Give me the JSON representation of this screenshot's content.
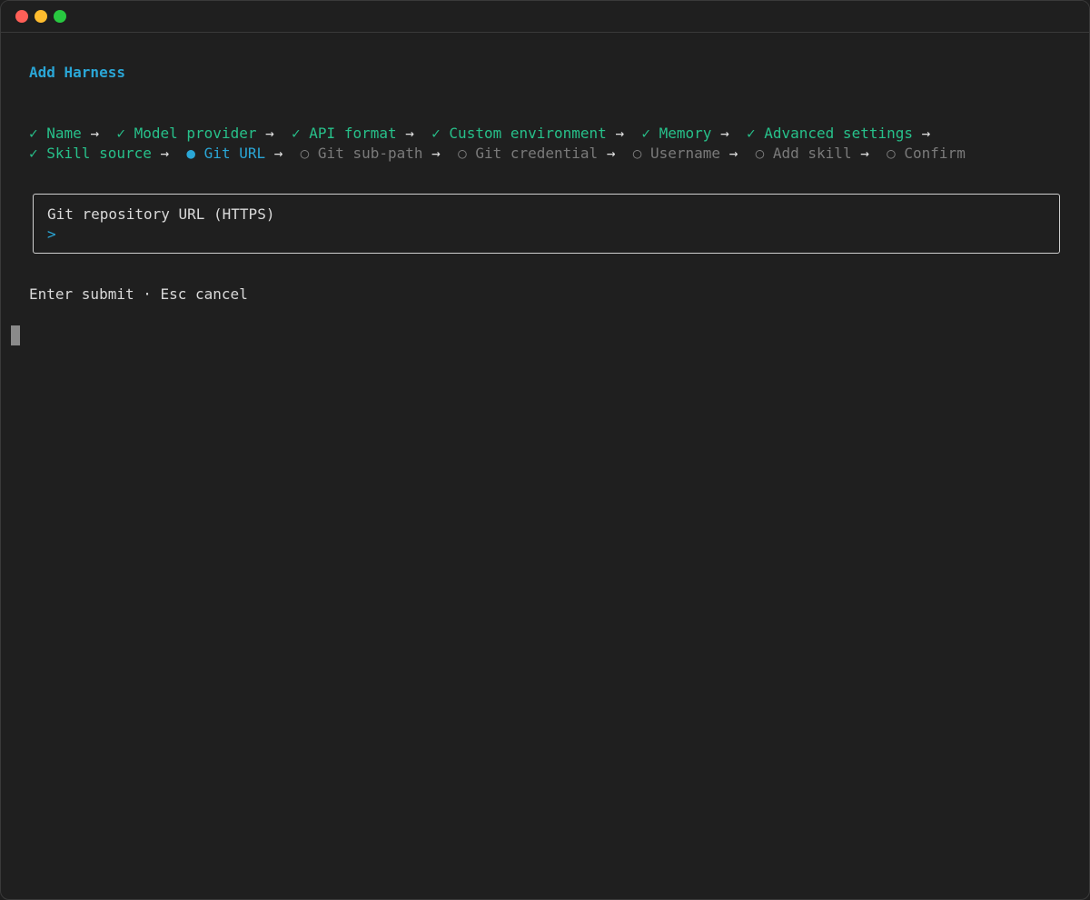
{
  "colors": {
    "title": "#2aa6d6",
    "done": "#27c08a",
    "current": "#2aa6d6",
    "pending": "#7a7a7a",
    "arrow": "#e0e0e0",
    "prompt": "#2aa6d6",
    "traffic_close": "#ff5f57",
    "traffic_minimize": "#febc2e",
    "traffic_maximize": "#28c840"
  },
  "header": {
    "title": "Add Harness"
  },
  "steps_row1": [
    {
      "label": "✓ Name",
      "state": "done"
    },
    {
      "label": "✓ Model provider",
      "state": "done"
    },
    {
      "label": "✓ API format",
      "state": "done"
    },
    {
      "label": "✓ Custom environment",
      "state": "done"
    },
    {
      "label": "✓ Memory",
      "state": "done"
    },
    {
      "label": "✓ Advanced settings",
      "state": "done"
    }
  ],
  "steps_row2": [
    {
      "label": "✓ Skill source",
      "state": "done"
    },
    {
      "label": "● Git URL",
      "state": "current"
    },
    {
      "label": "○ Git sub-path",
      "state": "pending"
    },
    {
      "label": "○ Git credential",
      "state": "pending"
    },
    {
      "label": "○ Username",
      "state": "pending"
    },
    {
      "label": "○ Add skill",
      "state": "pending"
    },
    {
      "label": "○ Confirm",
      "state": "pending"
    }
  ],
  "arrow": "→",
  "input": {
    "label": "Git repository URL (HTTPS)",
    "prompt": ">",
    "value": ""
  },
  "hint": "Enter submit · Esc cancel"
}
